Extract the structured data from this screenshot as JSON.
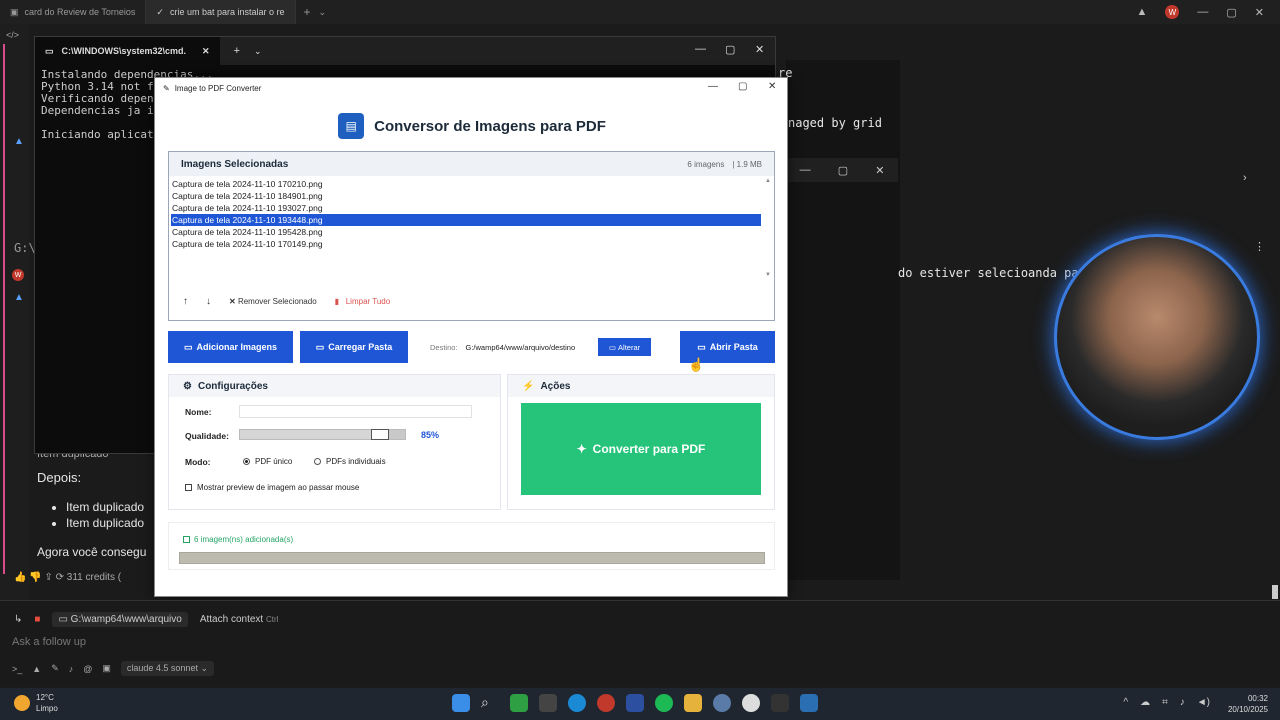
{
  "browser": {
    "tabs": [
      "card do Review de Torneios",
      "crie um bat para instalar o re"
    ],
    "new_tab": "+",
    "menu": "⌄",
    "profile_initial": "W"
  },
  "cmd": {
    "tab_title": "C:\\WINDOWS\\system32\\cmd.",
    "lines": [
      "Instalando dependencias...",
      "Python 3.14 not fou",
      "Verificando depende",
      "Dependencias ja ins",
      "",
      "Iniciando aplicativ"
    ],
    "right_fragment": "re"
  },
  "background": {
    "managed_text": "naged by grid",
    "selecting_text": "do estiver selecioanda para",
    "depois_label": "Depois:",
    "bullets": [
      "Item duplicado",
      "Item duplicado"
    ],
    "item_fragment": "Item duplicado",
    "agora_text": "Agora você consegu",
    "credits": "311 credits (",
    "left_path": "G:\\"
  },
  "app": {
    "window_title": "Image to PDF Converter",
    "header_title": "Conversor de Imagens para PDF",
    "panel": {
      "title": "Imagens Selecionadas",
      "count": "6 imagens",
      "size": "| 1.9 MB",
      "files": [
        "Captura de tela 2024-11-10 170210.png",
        "Captura de tela 2024-11-10 184901.png",
        "Captura de tela 2024-11-10 193027.png",
        "Captura de tela 2024-11-10 193448.png",
        "Captura de tela 2024-11-10 195428.png",
        "Captura de tela 2024-11-10 170149.png"
      ],
      "selected_index": 3,
      "remove_label": "Remover Selecionado",
      "clear_label": "Limpar Tudo"
    },
    "buttons": {
      "add_images": "Adicionar Imagens",
      "load_folder": "Carregar Pasta",
      "open_folder": "Abrir Pasta",
      "change": "Alterar"
    },
    "destination": {
      "label": "Destino:",
      "path": "G:/wamp64/www/arquivo/destino"
    },
    "settings": {
      "title": "Configurações",
      "name_label": "Nome:",
      "name_value": "",
      "quality_label": "Qualidade:",
      "quality_value": "85%",
      "quality_fraction": 0.85,
      "mode_label": "Modo:",
      "mode_single": "PDF único",
      "mode_multi": "PDFs individuais",
      "preview_label": "Mostrar preview de imagem ao passar mouse"
    },
    "actions": {
      "title": "Ações",
      "convert": "Converter para PDF"
    },
    "status": {
      "text": "6 imagem(ns) adicionada(s)",
      "progress": 0
    }
  },
  "ide": {
    "path": "G:\\wamp64\\www\\arquivo",
    "attach": "Attach context",
    "attach_key": "Ctrl",
    "follow_up_placeholder": "Ask a follow up",
    "model": "claude 4.5 sonnet"
  },
  "taskbar": {
    "temp": "12°C",
    "weather": "Limpo",
    "time": "00:32",
    "date": "20/10/2025"
  },
  "colors": {
    "primary": "#1e56d6",
    "success": "#25c47a",
    "danger": "#d9534f"
  }
}
